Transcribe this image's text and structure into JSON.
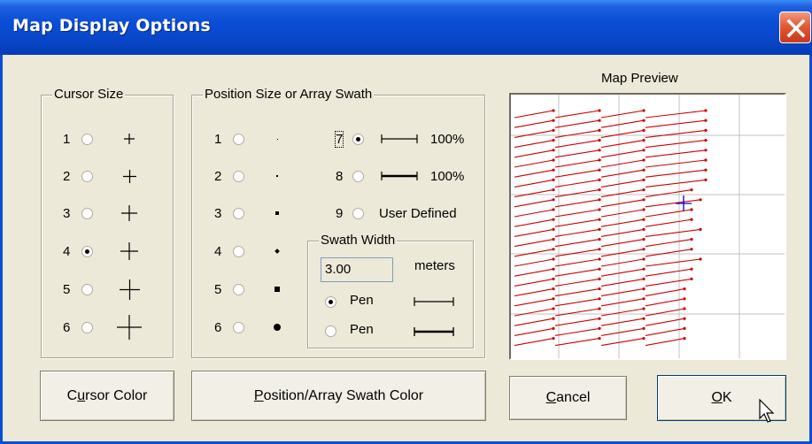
{
  "window": {
    "title": "Map Display Options"
  },
  "cursor_size": {
    "legend": "Cursor Size",
    "options": [
      {
        "num": "1",
        "selected": false
      },
      {
        "num": "2",
        "selected": false
      },
      {
        "num": "3",
        "selected": false
      },
      {
        "num": "4",
        "selected": true
      },
      {
        "num": "5",
        "selected": false
      },
      {
        "num": "6",
        "selected": false
      }
    ]
  },
  "position_size": {
    "legend": "Position Size or Array Swath",
    "options": [
      {
        "num": "1",
        "selected": false
      },
      {
        "num": "2",
        "selected": false
      },
      {
        "num": "3",
        "selected": false
      },
      {
        "num": "4",
        "selected": false
      },
      {
        "num": "5",
        "selected": false
      },
      {
        "num": "6",
        "selected": false
      },
      {
        "num": "7",
        "selected": true,
        "label": "100%"
      },
      {
        "num": "8",
        "selected": false,
        "label": "100%"
      },
      {
        "num": "9",
        "selected": false,
        "label": "User Defined"
      }
    ]
  },
  "swath_width": {
    "legend": "Swath Width",
    "value": "3.00",
    "unit": "meters",
    "pen1_label": "Pen",
    "pen2_label": "Pen",
    "pen1_selected": true,
    "pen2_selected": false
  },
  "preview": {
    "label": "Map Preview",
    "swath_color": "#cc0000",
    "cursor_color": "#0000cc",
    "grid_color": "#c0c0c0"
  },
  "buttons": {
    "cursor_color_hot": "u",
    "cursor_color_rest_1": "C",
    "cursor_color_rest_2": "rsor Color",
    "swath_color_hot": "P",
    "swath_color_rest": "osition/Array Swath Color",
    "cancel_hot": "C",
    "cancel_rest": "ancel",
    "ok_hot": "O",
    "ok_rest": "K"
  }
}
